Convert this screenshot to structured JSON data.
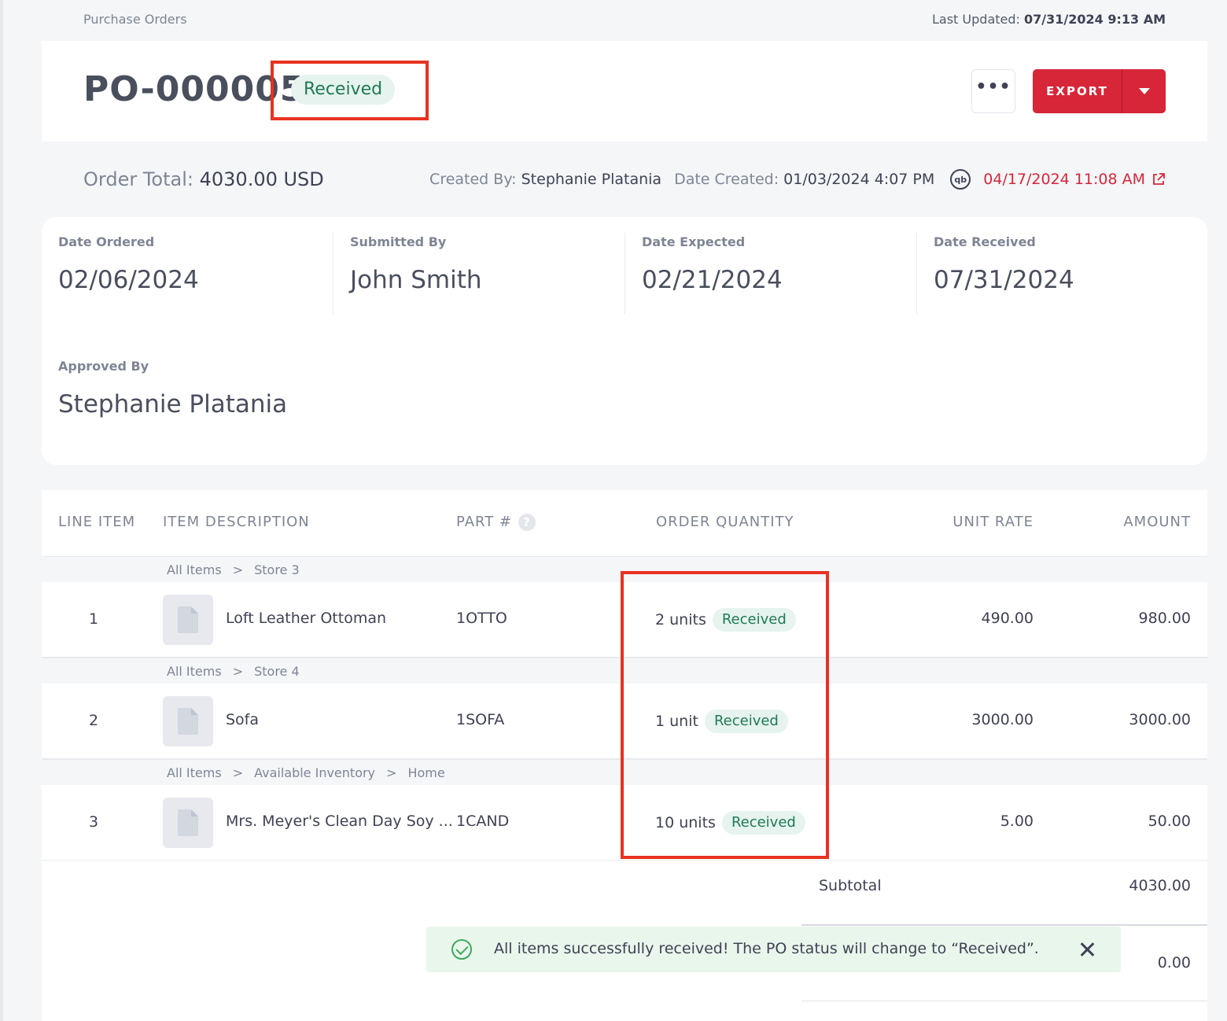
{
  "breadcrumb": "Purchase Orders",
  "last_updated": {
    "label": "Last Updated:",
    "value": "07/31/2024 9:13 AM"
  },
  "po": {
    "number": "PO-000005",
    "status": "Received",
    "more_label": "•••",
    "export_label": "EXPORT"
  },
  "summary": {
    "order_total_label": "Order Total:",
    "order_total_value": "4030.00 USD",
    "created_by_label": "Created By:",
    "created_by_value": "Stephanie Platania",
    "date_created_label": "Date Created:",
    "date_created_value": "01/03/2024 4:07 PM",
    "qb_icon": "qb",
    "qb_sync_date": "04/17/2024 11:08 AM"
  },
  "info": {
    "date_ordered_label": "Date Ordered",
    "date_ordered": "02/06/2024",
    "submitted_by_label": "Submitted By",
    "submitted_by": "John Smith",
    "date_expected_label": "Date Expected",
    "date_expected": "02/21/2024",
    "date_received_label": "Date Received",
    "date_received": "07/31/2024",
    "approved_by_label": "Approved By",
    "approved_by": "Stephanie Platania"
  },
  "table": {
    "headers": {
      "line_item": "LINE ITEM",
      "item_description": "ITEM DESCRIPTION",
      "part": "PART #",
      "help": "?",
      "order_quantity": "ORDER QUANTITY",
      "unit_rate": "UNIT RATE",
      "amount": "AMOUNT"
    },
    "rows": [
      {
        "path": [
          "All Items",
          ">",
          "Store 3"
        ],
        "line": "1",
        "description": "Loft Leather Ottoman",
        "part": "1OTTO",
        "quantity": "2 units",
        "status": "Received",
        "unit_rate": "490.00",
        "amount": "980.00"
      },
      {
        "path": [
          "All Items",
          ">",
          "Store 4"
        ],
        "line": "2",
        "description": "Sofa",
        "part": "1SOFA",
        "quantity": "1 unit",
        "status": "Received",
        "unit_rate": "3000.00",
        "amount": "3000.00"
      },
      {
        "path": [
          "All Items",
          ">",
          "Available Inventory",
          ">",
          "Home"
        ],
        "line": "3",
        "description": "Mrs. Meyer's Clean Day Soy ...",
        "part": "1CAND",
        "quantity": "10 units",
        "status": "Received",
        "unit_rate": "5.00",
        "amount": "50.00"
      }
    ],
    "subtotal_label": "Subtotal",
    "subtotal_value": "4030.00",
    "second_total_value": "0.00"
  },
  "toast": {
    "message": "All items successfully received! The PO status will change to “Received”."
  },
  "colors": {
    "accent_red": "#d72638",
    "status_green": "#1f7a55",
    "annotation_red": "#e8321f"
  }
}
